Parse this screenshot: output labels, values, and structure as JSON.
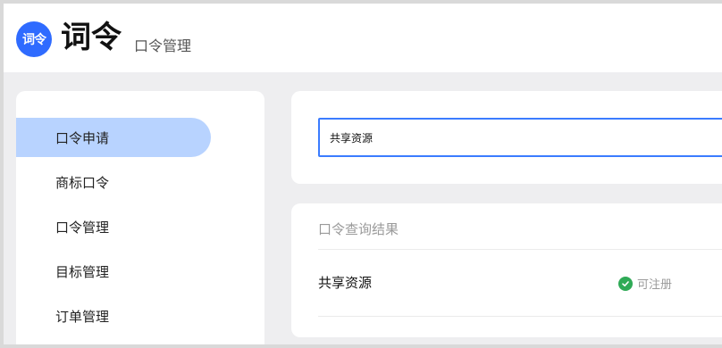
{
  "header": {
    "logo_text": "词令",
    "brand": "词令",
    "subtitle": "口令管理"
  },
  "sidebar": {
    "items": [
      {
        "label": "口令申请",
        "active": true
      },
      {
        "label": "商标口令",
        "active": false
      },
      {
        "label": "口令管理",
        "active": false
      },
      {
        "label": "目标管理",
        "active": false
      },
      {
        "label": "订单管理",
        "active": false
      }
    ]
  },
  "search": {
    "value": "共享资源"
  },
  "results": {
    "title": "口令查询结果",
    "rows": [
      {
        "name": "共享资源",
        "status": "可注册",
        "status_icon": "check-circle-icon"
      }
    ]
  },
  "colors": {
    "accent": "#3b7cff",
    "active_nav": "#b8d3ff",
    "success": "#2faa56"
  }
}
